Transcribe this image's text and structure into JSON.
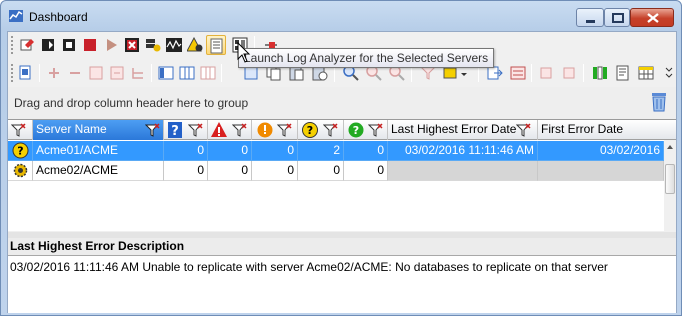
{
  "window": {
    "title": "Dashboard",
    "icons": {
      "app": "dashboard-app-icon",
      "minimize": "minimize-icon",
      "maximize": "maximize-icon",
      "close": "close-icon"
    }
  },
  "toolbar1": {
    "buttons": [
      "properties-icon",
      "start-all-icon",
      "stop-all-icon",
      "stop-icon",
      "play-icon",
      "cancel-icon",
      "server-replicate-icon",
      "performance-icon",
      "alert-warning-icon",
      "log-analyzer-icon",
      "layout-icon",
      "pin-icon"
    ]
  },
  "toolbar2": {
    "buttons": [
      "print-preview-icon",
      "add-row-icon",
      "remove-row-icon",
      "collapse-icon",
      "expand-icon",
      "tree-icon",
      "columns-left-icon",
      "columns-icon",
      "columns-right-icon",
      "select-icon",
      "copy-icon",
      "paste-icon",
      "paste-special-icon",
      "zoom-icon",
      "zoom-in-icon",
      "zoom-out-icon",
      "filter-icon",
      "highlight-icon",
      "export-icon",
      "align-icon",
      "undo-icon",
      "redo-icon",
      "bar-icon",
      "wrap-icon",
      "grid-icon"
    ]
  },
  "tooltip": {
    "text": "Launch Log Analyzer for the Selected Servers"
  },
  "groupbar": {
    "hint": "Drag and drop column header here to group"
  },
  "grid": {
    "columns": {
      "server_name": "Server Name",
      "last_highest_error_date": "Last Highest Error Date",
      "first_error_date": "First Error Date"
    },
    "rows": [
      {
        "status_icon": "question-icon",
        "server": "Acme01/ACME",
        "c1": "0",
        "c2": "0",
        "c3": "0",
        "c4": "2",
        "c5": "0",
        "last_date": "03/02/2016 11:11:46 AM",
        "first_date": "03/02/2016"
      },
      {
        "status_icon": "gear-icon",
        "server": "Acme02/ACME",
        "c1": "0",
        "c2": "0",
        "c3": "0",
        "c4": "0",
        "c5": "0",
        "last_date": "",
        "first_date": ""
      }
    ]
  },
  "description": {
    "header": "Last Highest Error Description",
    "text": "03/02/2016 11:11:46 AM  Unable to replicate with server Acme02/ACME: No databases to replicate on that server"
  },
  "colors": {
    "selection": "#3399ff",
    "header_selected": "#2b78d9",
    "error_red": "#d82020",
    "warning_orange": "#f08a00",
    "question_yellow": "#f5d000",
    "ok_green": "#22aa22",
    "info_blue": "#2360c8"
  }
}
